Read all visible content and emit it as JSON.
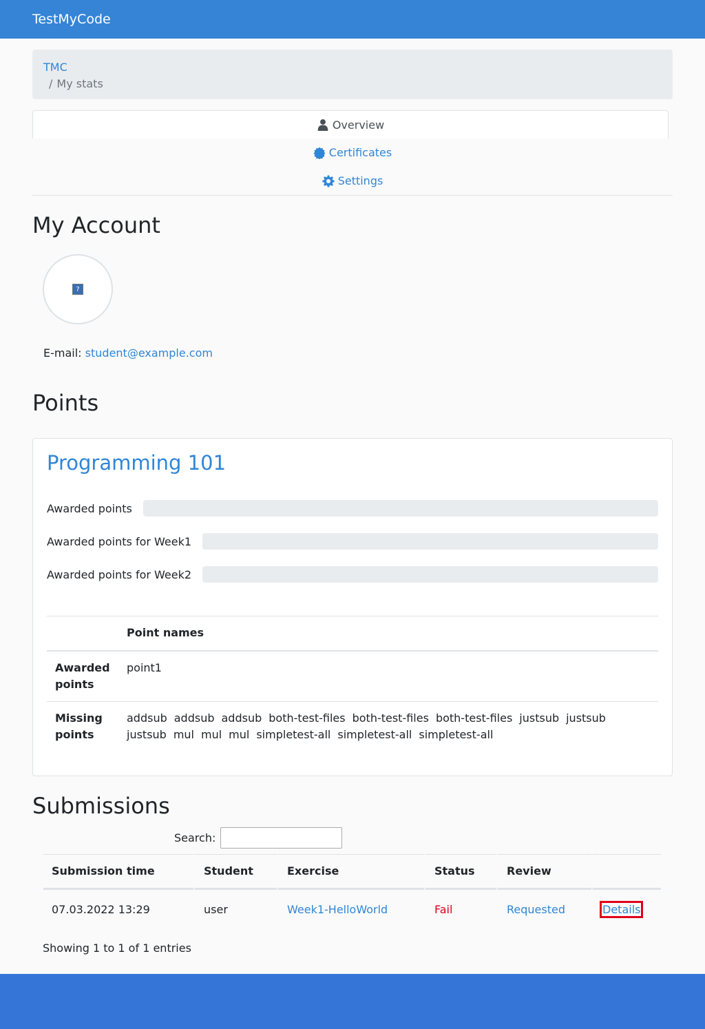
{
  "app": {
    "brand": "TestMyCode"
  },
  "breadcrumb": {
    "root": "TMC",
    "separator": "/",
    "current": "My stats"
  },
  "tabs": [
    {
      "label": "Overview",
      "icon": "user-icon",
      "active": true
    },
    {
      "label": "Certificates",
      "icon": "certificate-icon",
      "active": false
    },
    {
      "label": "Settings",
      "icon": "gear-icon",
      "active": false
    }
  ],
  "account": {
    "heading": "My Account",
    "avatar_icon": "broken-image-icon",
    "email_label": "E-mail:",
    "email": "student@example.com"
  },
  "points": {
    "heading": "Points",
    "course_title": "Programming 101",
    "progress": [
      {
        "label": "Awarded points",
        "value": 0
      },
      {
        "label": "Awarded points for Week1",
        "value": 0
      },
      {
        "label": "Awarded points for Week2",
        "value": 0
      }
    ],
    "table": {
      "header": "Point names",
      "awarded_label": "Awarded points",
      "awarded": [
        "point1"
      ],
      "missing_label": "Missing points",
      "missing": [
        "addsub",
        "addsub",
        "addsub",
        "both-test-files",
        "both-test-files",
        "both-test-files",
        "justsub",
        "justsub",
        "justsub",
        "mul",
        "mul",
        "mul",
        "simpletest-all",
        "simpletest-all",
        "simpletest-all"
      ]
    }
  },
  "submissions": {
    "heading": "Submissions",
    "search_label": "Search:",
    "search_value": "",
    "columns": [
      "Submission time",
      "Student",
      "Exercise",
      "Status",
      "Review",
      ""
    ],
    "rows": [
      {
        "time": "07.03.2022 13:29",
        "student": "user",
        "exercise": "Week1-HelloWorld",
        "status": "Fail",
        "review": "Requested",
        "details": "Details"
      }
    ],
    "info": "Showing 1 to 1 of 1 entries"
  },
  "colors": {
    "brand": "#3584d6",
    "link": "#2f86d6",
    "fail": "#e0001a",
    "footer": "#3675d8"
  }
}
